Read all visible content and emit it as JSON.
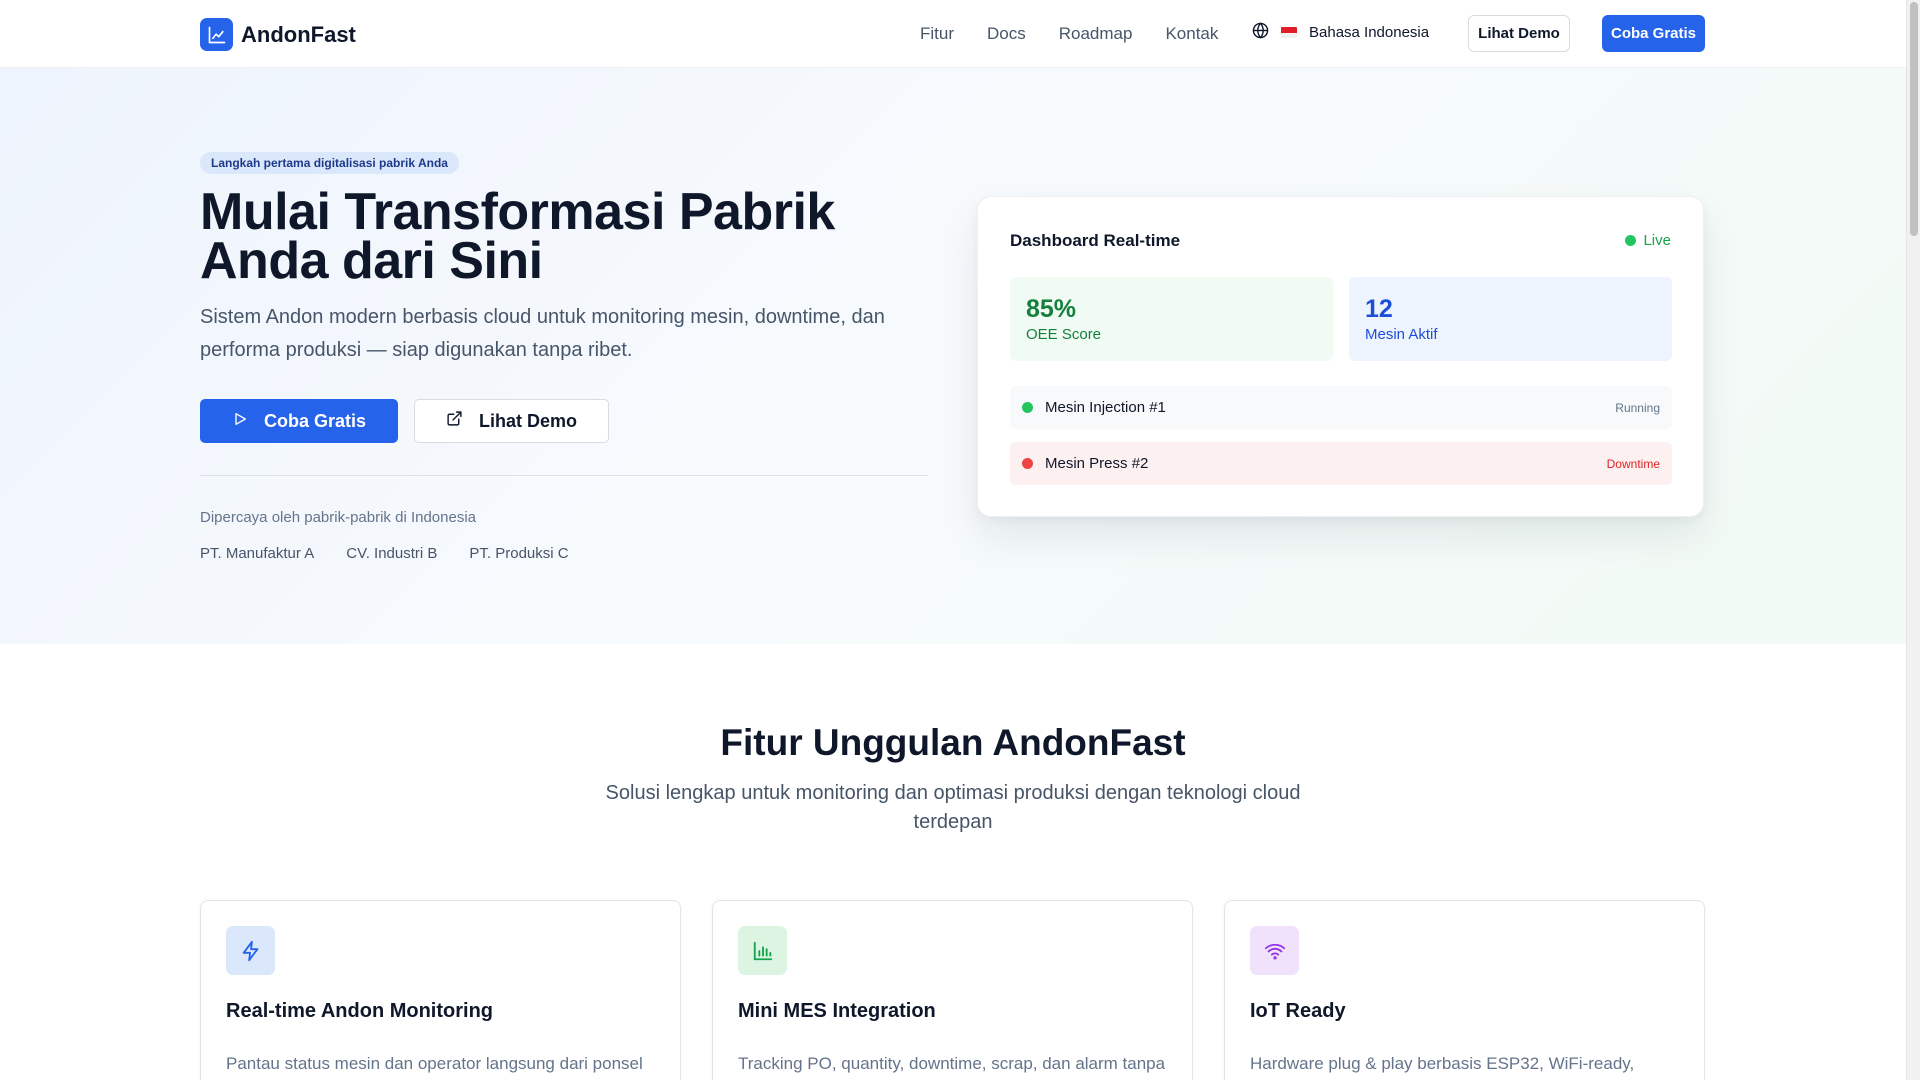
{
  "nav": {
    "brand": "AndonFast",
    "links": [
      "Fitur",
      "Docs",
      "Roadmap",
      "Kontak"
    ],
    "language": "Bahasa Indonesia",
    "demo_label": "Lihat Demo",
    "try_label": "Coba Gratis"
  },
  "hero": {
    "badge": "Langkah pertama digitalisasi pabrik Anda",
    "title": "Mulai Transformasi Pabrik Anda dari Sini",
    "subtitle": "Sistem Andon modern berbasis cloud untuk monitoring mesin, downtime, dan performa produksi — siap digunakan tanpa ribet.",
    "try_label": "Coba Gratis",
    "demo_label": "Lihat Demo",
    "trust_label": "Dipercaya oleh pabrik-pabrik di Indonesia",
    "trust_list": [
      "PT. Manufaktur A",
      "CV. Industri B",
      "PT. Produksi C"
    ]
  },
  "dashboard": {
    "title": "Dashboard Real-time",
    "live_label": "Live",
    "stats": [
      {
        "value": "85%",
        "label": "OEE Score"
      },
      {
        "value": "12",
        "label": "Mesin Aktif"
      }
    ],
    "machines": [
      {
        "name": "Mesin Injection #1",
        "status": "Running"
      },
      {
        "name": "Mesin Press #2",
        "status": "Downtime"
      }
    ]
  },
  "features": {
    "title": "Fitur Unggulan AndonFast",
    "subtitle": "Solusi lengkap untuk monitoring dan optimasi produksi dengan teknologi cloud terdepan",
    "cards": [
      {
        "icon": "lightning-icon",
        "title": "Real-time Andon Monitoring",
        "desc": "Pantau status mesin dan operator langsung dari ponsel"
      },
      {
        "icon": "bar-chart-icon",
        "title": "Mini MES Integration",
        "desc": "Tracking PO, quantity, downtime, scrap, dan alarm tanpa"
      },
      {
        "icon": "wifi-icon",
        "title": "IoT Ready",
        "desc": "Hardware plug & play berbasis ESP32, WiFi-ready,"
      }
    ]
  },
  "colors": {
    "primary": "#2563eb",
    "success": "#22c55e",
    "danger": "#ef4444"
  }
}
